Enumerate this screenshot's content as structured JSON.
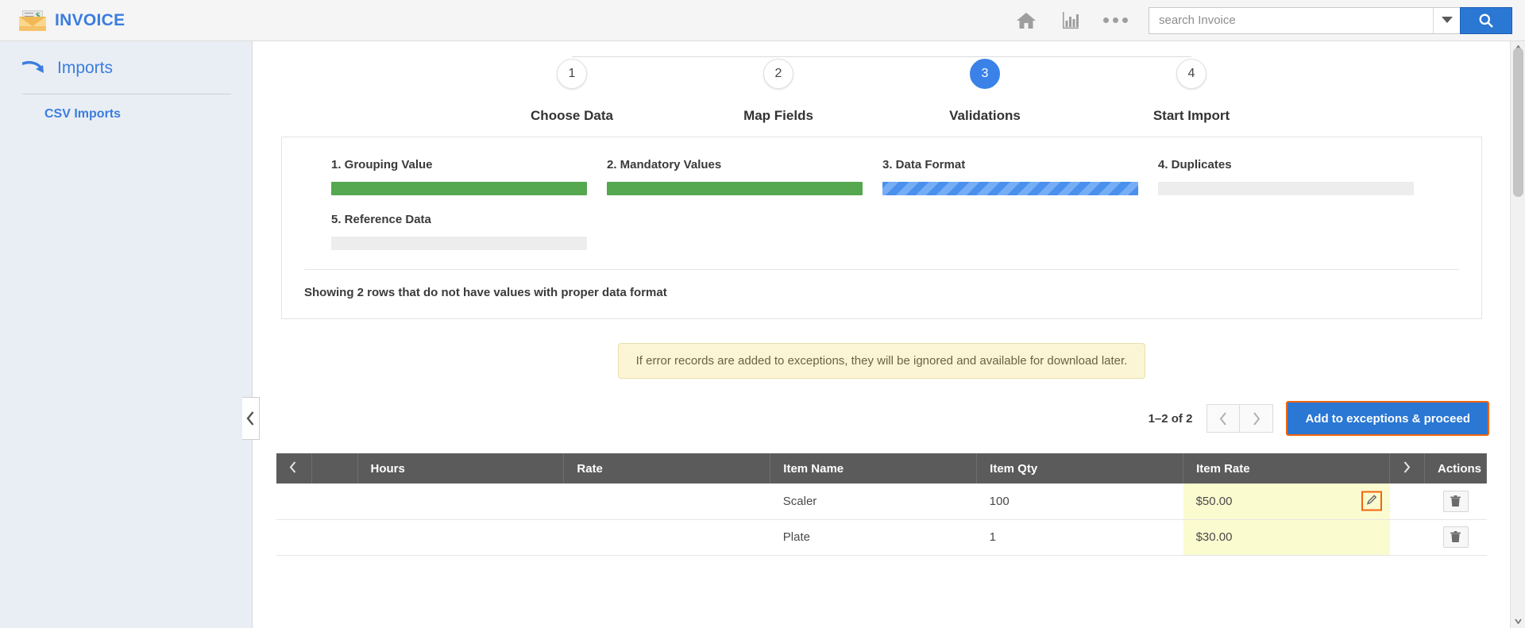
{
  "header": {
    "brand_title": "INVOICE",
    "brand_icon": "invoice-envelope-icon",
    "home_icon": "home-icon",
    "reports_icon": "bar-chart-icon",
    "more_icon": "more-dots-icon",
    "search_placeholder": "search Invoice",
    "search_value": "",
    "search_dropdown_icon": "chevron-down-icon",
    "search_button_icon": "search-icon",
    "accent_blue": "#2a77d4"
  },
  "sidebar": {
    "section_label": "Imports",
    "section_icon": "import-arrow-icon",
    "items": [
      {
        "label": "CSV Imports"
      }
    ],
    "collapse_icon": "chevron-left-icon"
  },
  "stepper": {
    "steps": [
      {
        "num": "1",
        "label": "Choose Data",
        "active": false
      },
      {
        "num": "2",
        "label": "Map Fields",
        "active": false
      },
      {
        "num": "3",
        "label": "Validations",
        "active": true
      },
      {
        "num": "4",
        "label": "Start Import",
        "active": false
      }
    ],
    "active_color": "#3b82e8"
  },
  "validations": {
    "bars": [
      {
        "label": "1. Grouping Value",
        "state": "complete",
        "color": "#55a84f",
        "percent": 100
      },
      {
        "label": "2. Mandatory Values",
        "state": "complete",
        "color": "#55a84f",
        "percent": 100
      },
      {
        "label": "3. Data Format",
        "state": "in-progress",
        "color": "#4a90ed",
        "percent": 100
      },
      {
        "label": "4. Duplicates",
        "state": "pending",
        "color": "#ededed",
        "percent": 0
      },
      {
        "label": "5. Reference Data",
        "state": "pending",
        "color": "#ededed",
        "percent": 0
      }
    ],
    "note": "Showing 2 rows that do not have values with proper data format"
  },
  "callout": {
    "text": "If error records are added to exceptions, they will be ignored and available for download later."
  },
  "pagination": {
    "range_text": "1–2 of 2",
    "prev_icon": "chevron-left-icon",
    "next_icon": "chevron-right-icon",
    "proceed_label": "Add to exceptions & proceed",
    "highlight_color": "#f4650c"
  },
  "table": {
    "nav_left_icon": "chevron-left-icon",
    "nav_right_icon": "chevron-right-icon",
    "columns": [
      "Hours",
      "Rate",
      "Item Name",
      "Item Qty",
      "Item Rate"
    ],
    "actions_label": "Actions",
    "rows": [
      {
        "hours": "",
        "rate": "",
        "item_name": "Scaler",
        "item_qty": "100",
        "item_rate": "$50.00",
        "rate_error": true,
        "edit_focused": true,
        "edit_icon": "pencil-icon",
        "delete_icon": "trash-icon"
      },
      {
        "hours": "",
        "rate": "",
        "item_name": "Plate",
        "item_qty": "1",
        "item_rate": "$30.00",
        "rate_error": true,
        "edit_focused": false,
        "edit_icon": "pencil-icon",
        "delete_icon": "trash-icon"
      }
    ]
  }
}
